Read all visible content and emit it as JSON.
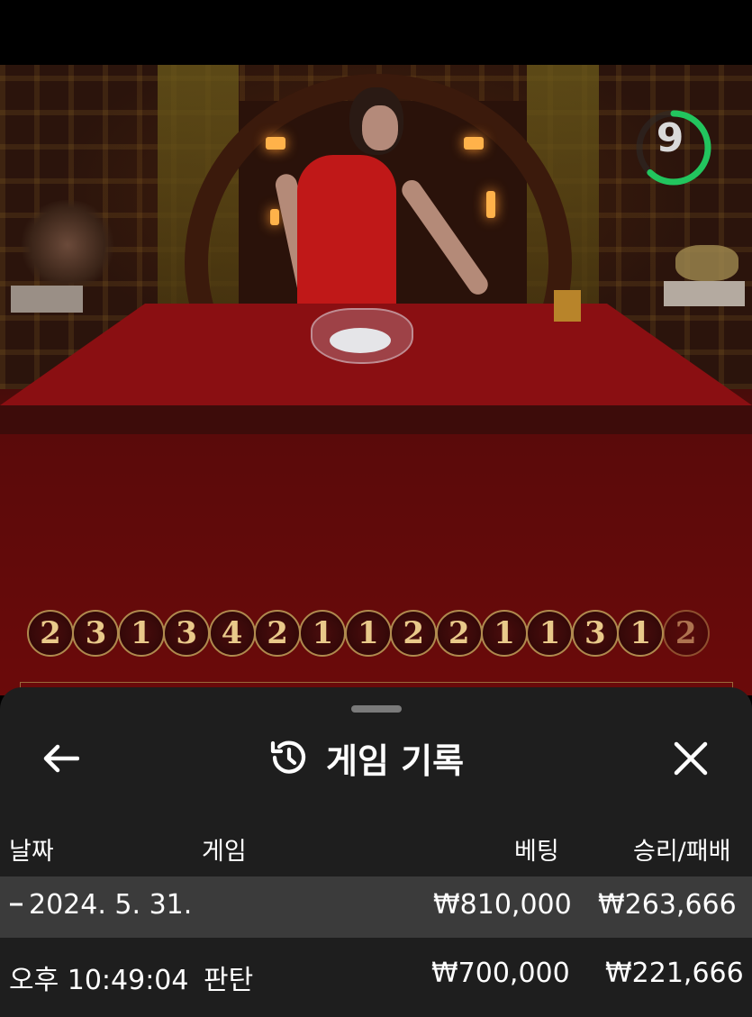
{
  "game": {
    "timer_value": "9",
    "timer_progress": 0.62,
    "timer_color": "#22c55e",
    "recent_results": [
      "2",
      "3",
      "1",
      "3",
      "4",
      "2",
      "1",
      "1",
      "2",
      "2",
      "1",
      "1",
      "3",
      "1",
      "2"
    ]
  },
  "history_panel": {
    "title": "게임 기록",
    "back_icon": "arrow-left-icon",
    "history_icon": "history-icon",
    "close_icon": "close-icon",
    "columns": {
      "date": "날짜",
      "game": "게임",
      "bet": "베팅",
      "win_loss": "승리/패배"
    },
    "day_group": {
      "date_label": "2024. 5. 31.",
      "collapse_icon": "minus-icon",
      "bet_total": "₩810,000",
      "win_loss_total": "₩263,666"
    },
    "rows": [
      {
        "time": "오후 10:49:04",
        "game": "판탄",
        "bet": "₩700,000",
        "win_loss": "₩221,666"
      }
    ]
  }
}
